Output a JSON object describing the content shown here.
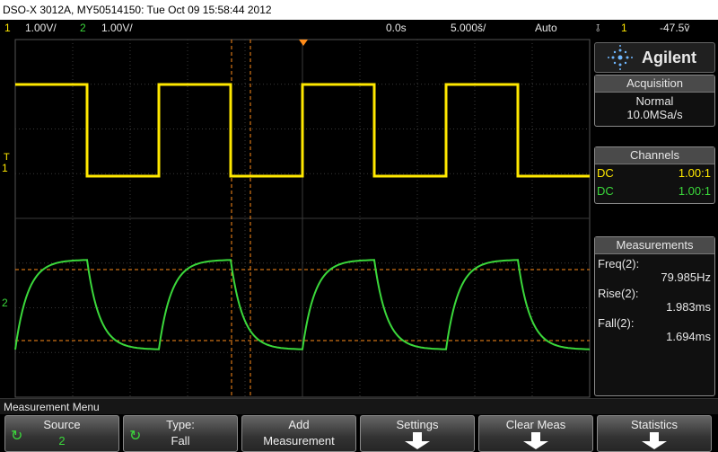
{
  "title": "DSO-X 3012A, MY50514150: Tue Oct 09 15:58:44 2012",
  "status": {
    "ch1_num": "1",
    "ch1_scale": "1.00V/",
    "ch2_num": "2",
    "ch2_scale": "1.00V/",
    "delay": "0.0s",
    "timebase": "5.000š/",
    "mode": "Auto",
    "trigger_icon": "falling-edge-trigger",
    "trigger_source": "1",
    "trigger_level": "-47.5ṽ"
  },
  "markers": {
    "ch1": "1",
    "ch2": "2",
    "trigger": "T"
  },
  "side": {
    "brand": "Agilent",
    "acquisition_header": "Acquisition",
    "acq_mode": "Normal",
    "sample_rate": "10.0MSa/s",
    "channels_header": "Channels",
    "ch1_coupling": "DC",
    "ch1_probe": "1.00:1",
    "ch2_coupling": "DC",
    "ch2_probe": "1.00:1",
    "measurements_header": "Measurements",
    "meas": [
      {
        "label": "Freq(2):",
        "value": "79.985Hz"
      },
      {
        "label": "Rise(2):",
        "value": "1.983ms"
      },
      {
        "label": "Fall(2):",
        "value": "1.694ms"
      }
    ]
  },
  "menu_title": "Measurement Menu",
  "softkeys": [
    {
      "line1": "Source",
      "line2": "2",
      "icon": "rotate-knob-icon"
    },
    {
      "line1": "Type:",
      "line2": "Fall",
      "icon": "rotate-knob-icon"
    },
    {
      "line1": "Add",
      "line2": "Measurement"
    },
    {
      "line1": "Settings",
      "line2": "",
      "icon": "submenu-arrow-icon"
    },
    {
      "line1": "Clear Meas",
      "line2": "",
      "icon": "submenu-arrow-icon"
    },
    {
      "line1": "Statistics",
      "line2": "",
      "icon": "submenu-arrow-icon"
    }
  ],
  "colors": {
    "ch1": "#ffe800",
    "ch2": "#3bd83b",
    "cursor": "#ff8c1a",
    "grid": "#3a3a3a"
  },
  "waveforms": {
    "ch1": "square",
    "ch2": "rc-charge-discharge"
  }
}
